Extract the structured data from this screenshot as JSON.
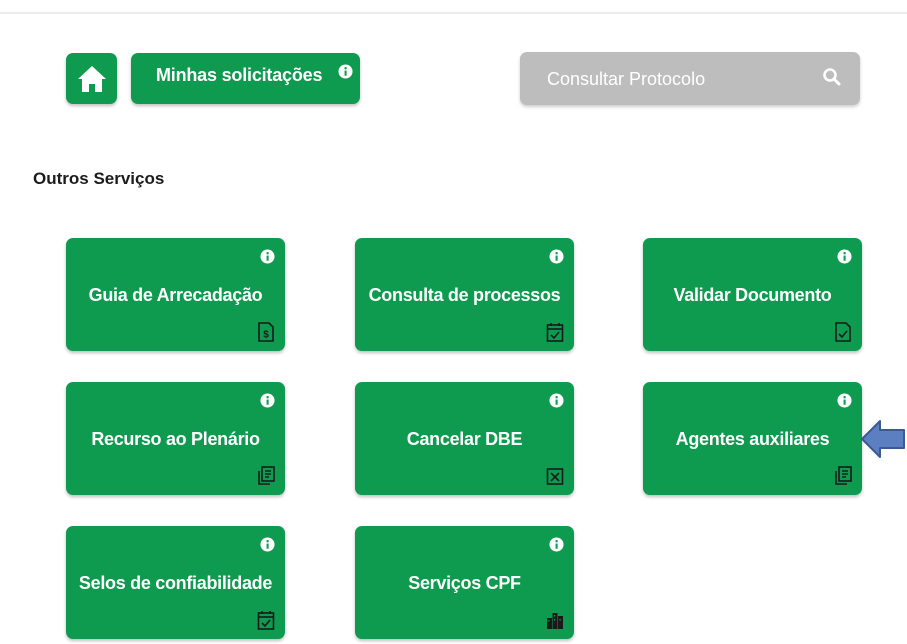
{
  "header": {
    "my_requests_label": "Minhas solicitações"
  },
  "search": {
    "placeholder": "Consultar Protocolo"
  },
  "section": {
    "title": "Outros Serviços"
  },
  "cards": [
    {
      "label": "Guia de Arrecadação",
      "icon": "money-document-icon"
    },
    {
      "label": "Consulta de processos",
      "icon": "calendar-check-icon"
    },
    {
      "label": "Validar Documento",
      "icon": "document-check-icon"
    },
    {
      "label": "Recurso ao Plenário",
      "icon": "documents-list-icon"
    },
    {
      "label": "Cancelar DBE",
      "icon": "cancel-box-icon"
    },
    {
      "label": "Agentes auxiliares",
      "icon": "documents-list-icon"
    },
    {
      "label": "Selos de confiabilidade",
      "icon": "calendar-check-icon"
    },
    {
      "label": "Serviços CPF",
      "icon": "buildings-icon"
    }
  ],
  "colors": {
    "primary_green": "#0e9a4f",
    "search_gray": "#bdbdbd",
    "arrow_blue": "#5b7fc0"
  }
}
